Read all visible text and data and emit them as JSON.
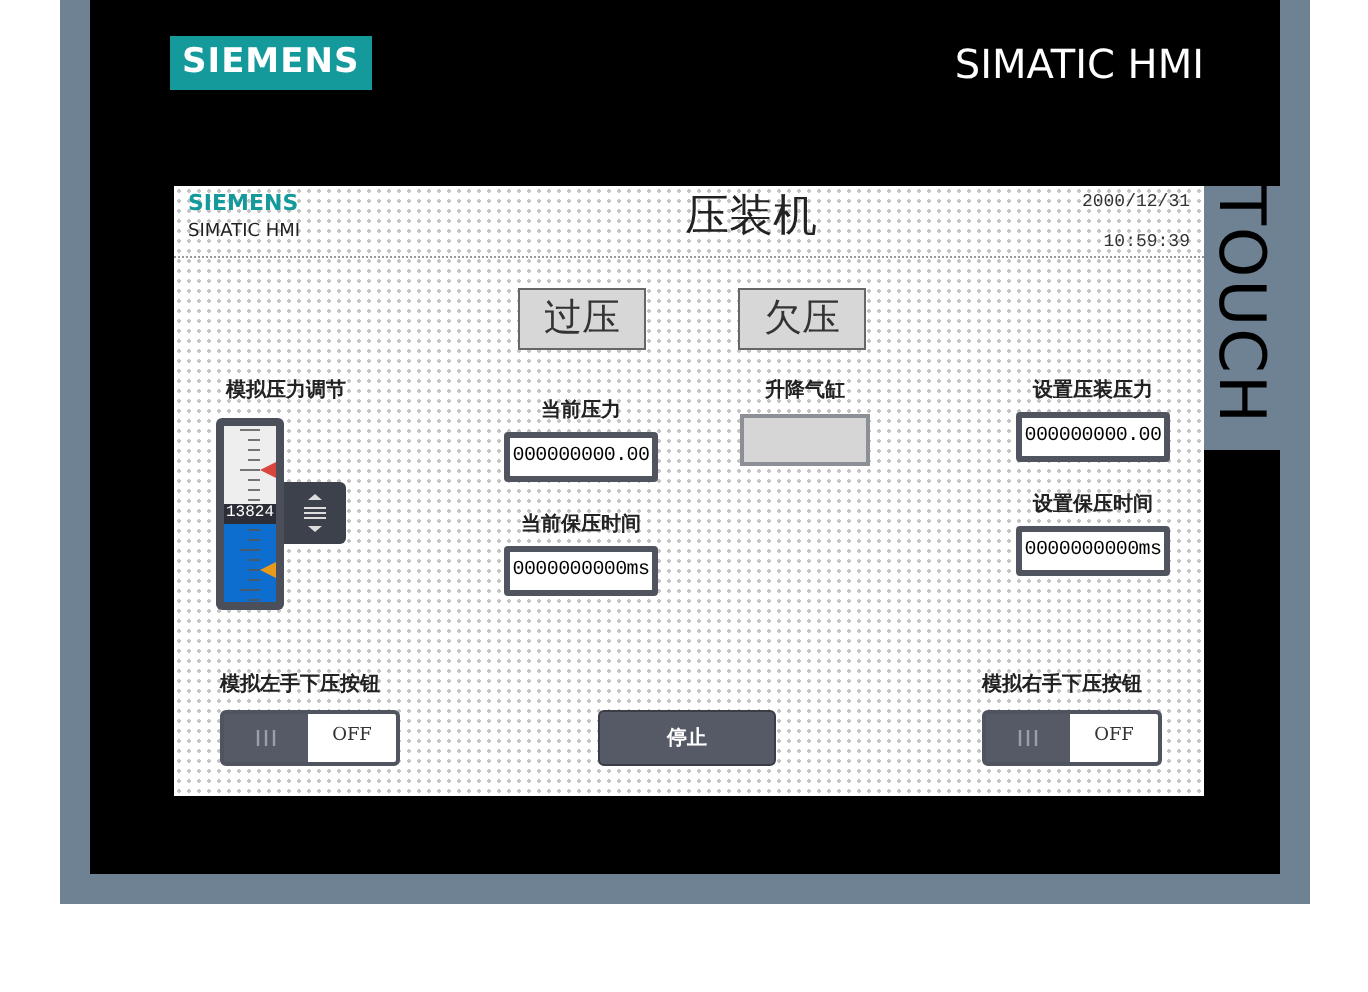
{
  "device": {
    "brand": "SIEMENS",
    "model": "SIMATIC HMI",
    "touch_label": "TOUCH"
  },
  "screen": {
    "brand": "SIEMENS",
    "model": "SIMATIC HMI",
    "title": "压装机",
    "date": "2000/12/31",
    "time": "10:59:39",
    "alarms": [
      {
        "label": "过压"
      },
      {
        "label": "欠压"
      }
    ],
    "slider": {
      "label": "模拟压力调节",
      "value": "13824",
      "level": 0.5
    },
    "current_fields": [
      {
        "label": "当前压力",
        "value": "000000000.00"
      },
      {
        "label": "当前保压时间",
        "value": "0000000000ms"
      }
    ],
    "cylinder": {
      "label": "升降气缸",
      "on": false
    },
    "set_fields": [
      {
        "label": "设置压装压力",
        "value": "000000000.00"
      },
      {
        "label": "设置保压时间",
        "value": "0000000000ms"
      }
    ],
    "toggles": [
      {
        "label": "模拟左手下压按钮",
        "state_text": "OFF",
        "on": false
      },
      {
        "label": "模拟右手下压按钮",
        "state_text": "OFF",
        "on": false
      }
    ],
    "stop_button": "停止"
  }
}
